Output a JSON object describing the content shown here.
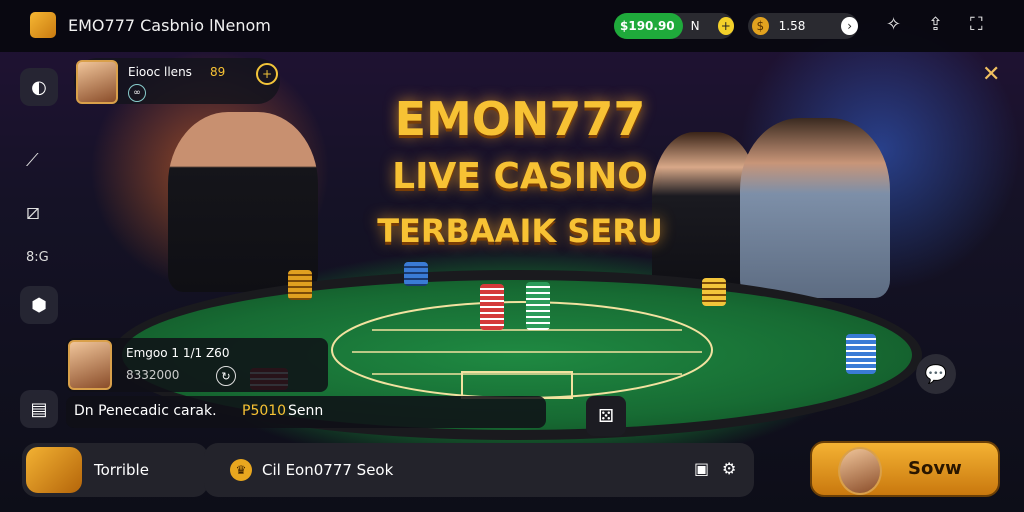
{
  "app": {
    "title": "EMO777 Casbnio lNenom"
  },
  "topbar": {
    "balance_value": "$190.90",
    "balance_suffix": "N",
    "coins_value": "1.58",
    "icons": [
      "logo-icon",
      "add-icon",
      "coin-icon",
      "arrow-right-icon",
      "profile-icon",
      "share-icon",
      "expand-icon"
    ]
  },
  "player_card": {
    "name": "Eiooc llens",
    "level": "89"
  },
  "headline": {
    "line1": "EMON777",
    "line2": "LIVE CASINO",
    "line3": "TERBAAIK SERU"
  },
  "sidebar": {
    "label": "8:G",
    "icons": [
      "globe-icon",
      "pen-icon",
      "slash-box-icon",
      "location-icon",
      "card-icon"
    ]
  },
  "info_card": {
    "name": "Emgoo 1 1/1 Z60",
    "amount": "8332000"
  },
  "message": {
    "text": "Dn Penecadic carak.",
    "highlight": "P5010",
    "suffix": "Senn"
  },
  "bottom": {
    "left_label": "Torrible",
    "mid_label": "Cil Eon0777 Seok",
    "right_label": "Sovw"
  },
  "colors": {
    "accent_gold": "#f7c234",
    "balance_green": "#1faa3b",
    "table_green": "#1f8a42"
  }
}
